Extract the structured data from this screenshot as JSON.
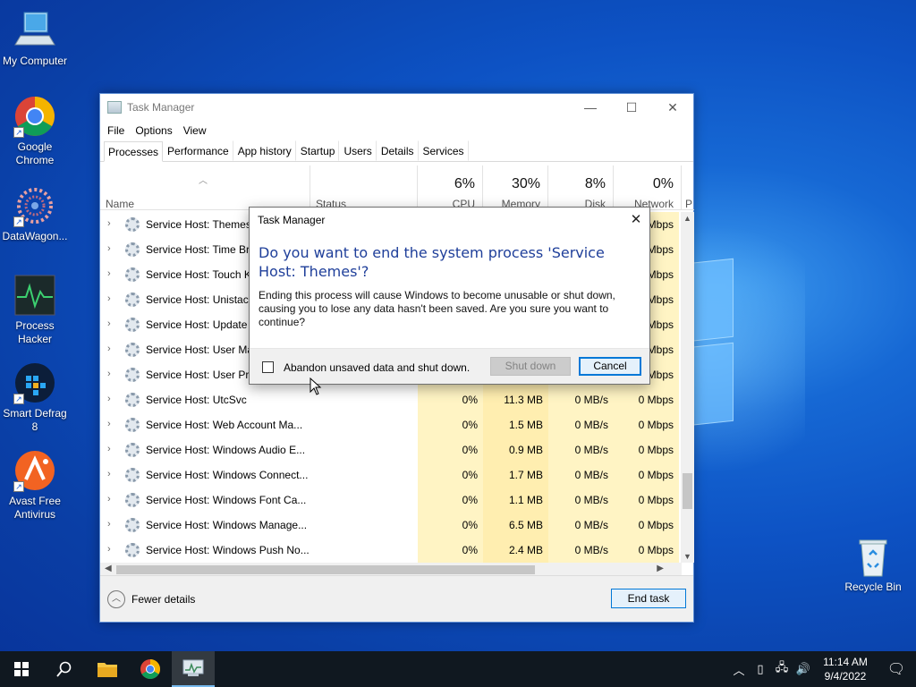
{
  "desktop": {
    "icons": [
      {
        "label": "My Computer",
        "icon": "computer-icon"
      },
      {
        "label": "Google Chrome",
        "icon": "chrome-icon"
      },
      {
        "label": "DataWagon...",
        "icon": "datawagon-icon"
      },
      {
        "label": "Process Hacker",
        "icon": "process-hacker-icon"
      },
      {
        "label": "Smart Defrag 8",
        "icon": "smart-defrag-icon"
      },
      {
        "label": "Avast Free Antivirus",
        "icon": "avast-icon"
      }
    ],
    "recycle_bin": {
      "label": "Recycle Bin",
      "icon": "recycle-bin-icon"
    }
  },
  "task_manager": {
    "title": "Task Manager",
    "caption_buttons": {
      "minimize": "—",
      "maximize": "☐",
      "close": "✕"
    },
    "menu": [
      "File",
      "Options",
      "View"
    ],
    "tabs": [
      "Processes",
      "Performance",
      "App history",
      "Startup",
      "Users",
      "Details",
      "Services"
    ],
    "active_tab": "Processes",
    "columns": {
      "name": "Name",
      "status": "Status",
      "cpu": {
        "pct": "6%",
        "label": "CPU"
      },
      "memory": {
        "pct": "30%",
        "label": "Memory"
      },
      "disk": {
        "pct": "8%",
        "label": "Disk"
      },
      "network": {
        "pct": "0%",
        "label": "Network"
      },
      "power": "P"
    },
    "rows": [
      {
        "name": "Service Host: Themes",
        "cpu": "",
        "mem": "",
        "disk": "",
        "net": "Mbps"
      },
      {
        "name": "Service Host: Time Bro",
        "cpu": "",
        "mem": "",
        "disk": "",
        "net": "Mbps"
      },
      {
        "name": "Service Host: Touch Ke",
        "cpu": "",
        "mem": "",
        "disk": "",
        "net": "Mbps"
      },
      {
        "name": "Service Host: Unistack",
        "cpu": "",
        "mem": "",
        "disk": "",
        "net": "Mbps"
      },
      {
        "name": "Service Host: Update O",
        "cpu": "",
        "mem": "",
        "disk": "",
        "net": "Mbps"
      },
      {
        "name": "Service Host: User Ma",
        "cpu": "",
        "mem": "",
        "disk": "",
        "net": "Mbps"
      },
      {
        "name": "Service Host: User Pro",
        "cpu": "",
        "mem": "",
        "disk": "",
        "net": "Mbps"
      },
      {
        "name": "Service Host: UtcSvc",
        "cpu": "0%",
        "mem": "11.3 MB",
        "disk": "0 MB/s",
        "net": "0 Mbps"
      },
      {
        "name": "Service Host: Web Account Ma...",
        "cpu": "0%",
        "mem": "1.5 MB",
        "disk": "0 MB/s",
        "net": "0 Mbps"
      },
      {
        "name": "Service Host: Windows Audio E...",
        "cpu": "0%",
        "mem": "0.9 MB",
        "disk": "0 MB/s",
        "net": "0 Mbps"
      },
      {
        "name": "Service Host: Windows Connect...",
        "cpu": "0%",
        "mem": "1.7 MB",
        "disk": "0 MB/s",
        "net": "0 Mbps"
      },
      {
        "name": "Service Host: Windows Font Ca...",
        "cpu": "0%",
        "mem": "1.1 MB",
        "disk": "0 MB/s",
        "net": "0 Mbps"
      },
      {
        "name": "Service Host: Windows Manage...",
        "cpu": "0%",
        "mem": "6.5 MB",
        "disk": "0 MB/s",
        "net": "0 Mbps"
      },
      {
        "name": "Service Host: Windows Push No...",
        "cpu": "0%",
        "mem": "2.4 MB",
        "disk": "0 MB/s",
        "net": "0 Mbps"
      }
    ],
    "footer": {
      "fewer_details": "Fewer details",
      "end_task": "End task"
    }
  },
  "dialog": {
    "title": "Task Manager",
    "heading": "Do you want to end the system process 'Service Host: Themes'?",
    "body": "Ending this process will cause Windows to become unusable or shut down, causing you to lose any data hasn't been saved. Are you sure you want to continue?",
    "checkbox_label": "Abandon unsaved data and shut down.",
    "checkbox_checked": false,
    "shutdown_label": "Shut down",
    "cancel_label": "Cancel"
  },
  "taskbar": {
    "pinned": [
      "start-icon",
      "search-icon",
      "file-explorer-icon",
      "chrome-icon",
      "task-manager-icon"
    ],
    "clock": {
      "time": "11:14 AM",
      "date": "9/4/2022"
    },
    "tray_icons": [
      "chevron-up-icon",
      "tablet-icon",
      "network-icon",
      "volume-icon",
      "notification-icon"
    ]
  },
  "colors": {
    "dialog_heading": "#1f3f9a",
    "accent": "#0078d7",
    "heatmap_light": "#fff4c4"
  }
}
